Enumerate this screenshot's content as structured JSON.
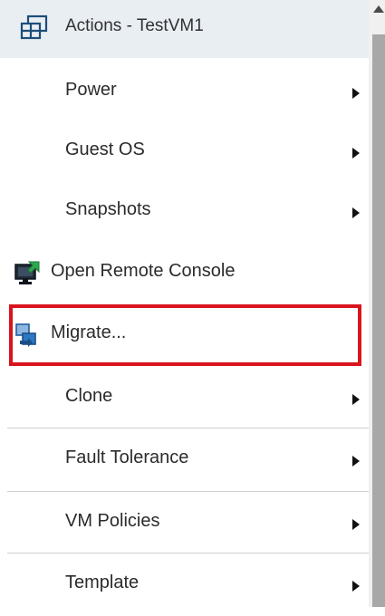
{
  "header": {
    "title": "Actions - TestVM1",
    "icon": "vm-group-icon"
  },
  "items": [
    {
      "label": "Power",
      "has_submenu": true
    },
    {
      "label": "Guest OS",
      "has_submenu": true
    },
    {
      "label": "Snapshots",
      "has_submenu": true
    },
    {
      "label": "Open Remote Console",
      "has_submenu": false,
      "icon": "remote-console-icon"
    },
    {
      "label": "Migrate...",
      "has_submenu": false,
      "icon": "migrate-icon",
      "highlighted": true
    },
    {
      "label": "Clone",
      "has_submenu": true
    },
    {
      "label": "Fault Tolerance",
      "has_submenu": true
    },
    {
      "label": "VM Policies",
      "has_submenu": true
    },
    {
      "label": "Template",
      "has_submenu": true
    }
  ],
  "colors": {
    "header_bg": "#e9eef3",
    "highlight_border": "#d9141e",
    "text": "#2b2b2b"
  }
}
